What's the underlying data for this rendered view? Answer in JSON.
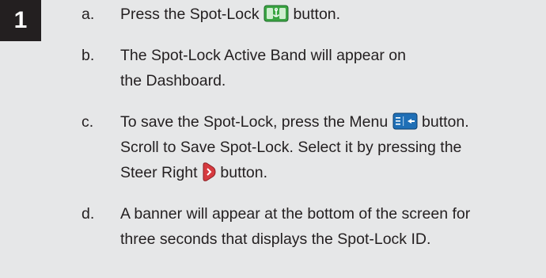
{
  "step": {
    "number": "1"
  },
  "items": [
    {
      "letter": "a.",
      "before": "Press the Spot-Lock",
      "icon": "spot-lock-button-icon",
      "after": "button."
    },
    {
      "letter": "b.",
      "line1": "The Spot-Lock Active Band will appear on",
      "line2": "the Dashboard."
    },
    {
      "letter": "c.",
      "line1_before": "To save the Spot-Lock, press the Menu",
      "icon1": "menu-button-icon",
      "line1_after": "button.",
      "line2": "Scroll to Save Spot-Lock. Select it by pressing the",
      "line3_before": "Steer Right",
      "icon2": "steer-right-button-icon",
      "line3_after": "button."
    },
    {
      "letter": "d.",
      "line1": "A banner will appear at the bottom of the screen for",
      "line2": "three seconds that displays the Spot-Lock ID."
    }
  ],
  "colors": {
    "background": "#e6e7e8",
    "text": "#231f20",
    "spot_lock_icon": "#3aa542",
    "menu_icon": "#1f6fb6",
    "steer_right_icon": "#d63a3f"
  }
}
